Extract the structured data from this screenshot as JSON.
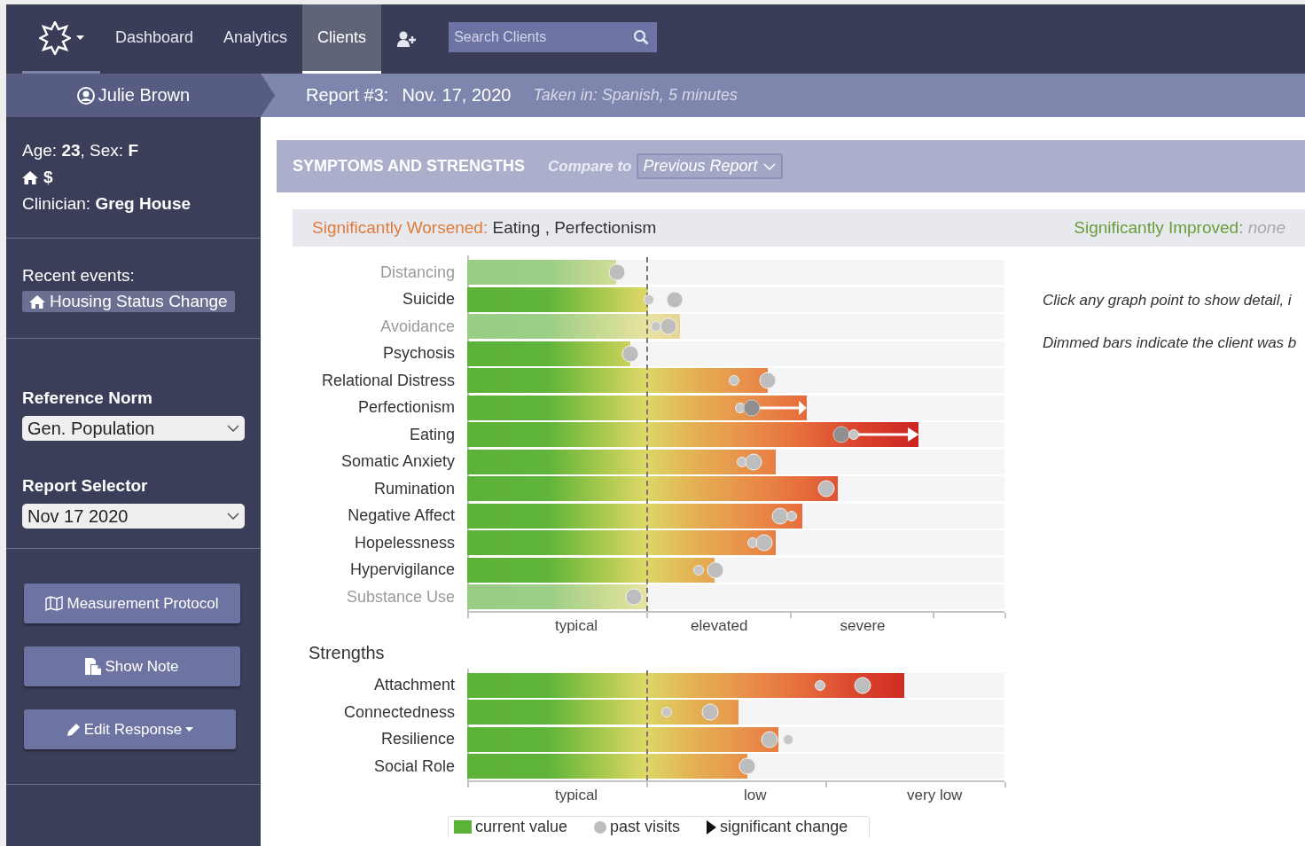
{
  "nav": {
    "items": [
      {
        "label": "Dashboard",
        "selected": false
      },
      {
        "label": "Analytics",
        "selected": false
      },
      {
        "label": "Clients",
        "selected": true
      }
    ],
    "search": {
      "placeholder": "Search Clients"
    }
  },
  "client": {
    "name": "Julie Brown",
    "age_line": "Age: **23**,  Sex: **F**",
    "flag": "$",
    "clinician_line": "Clinician: **Greg House**",
    "events_label": "Recent events:",
    "events": [
      "Housing Status Change"
    ]
  },
  "report": {
    "title": "Report #3:",
    "date": "Nov. 17, 2020",
    "taken": "Taken in: Spanish, 5 minutes"
  },
  "controls": [
    {
      "label": "Reference Norm",
      "value": "Gen. Population"
    },
    {
      "label": "Report Selector",
      "value": "Nov 17 2020"
    }
  ],
  "actions": [
    {
      "label": "Measurement Protocol",
      "kind": "map",
      "has_menu": false
    },
    {
      "label": "Show Note",
      "kind": "note",
      "has_menu": false
    },
    {
      "label": "Edit Response",
      "kind": "edit",
      "has_menu": true
    }
  ],
  "panel": {
    "title": "SYMPTOMS AND STRENGTHS",
    "compare_label": "Compare to",
    "compare_value": "Previous Report",
    "worsened_label": "Significantly Worsened:",
    "worsened": "Eating , Perfectionism",
    "improved_label": "Significantly Improved:",
    "improved": "none",
    "notes": [
      "Click any graph point to show detail, i",
      "Dimmed bars indicate the client was b"
    ]
  },
  "symptoms": {
    "axis_labels": [
      "typical",
      "elevated",
      "severe"
    ],
    "rows": [
      {
        "label": "Distancing",
        "dimmed": true,
        "significant_change": false,
        "level": 0.277,
        "markers": [
          {
            "kind": "large",
            "level": 0.279
          }
        ]
      },
      {
        "label": "Suicide",
        "dimmed": false,
        "significant_change": false,
        "level": 0.337,
        "markers": [
          {
            "kind": "small",
            "level": 0.338
          },
          {
            "kind": "large",
            "level": 0.386
          }
        ]
      },
      {
        "label": "Avoidance",
        "dimmed": true,
        "significant_change": false,
        "level": 0.396,
        "markers": [
          {
            "kind": "small",
            "level": 0.351
          },
          {
            "kind": "large",
            "level": 0.375
          }
        ]
      },
      {
        "label": "Psychosis",
        "dimmed": false,
        "significant_change": false,
        "level": 0.304,
        "markers": [
          {
            "kind": "large",
            "level": 0.304
          }
        ]
      },
      {
        "label": "Relational Distress",
        "dimmed": false,
        "significant_change": false,
        "level": 0.559,
        "markers": [
          {
            "kind": "small",
            "level": 0.497
          },
          {
            "kind": "large",
            "level": 0.559
          }
        ]
      },
      {
        "label": "Perfectionism",
        "dimmed": false,
        "significant_change": true,
        "level": 0.632,
        "markers": [
          {
            "kind": "small",
            "level": 0.508
          },
          {
            "kind": "large-dark",
            "level": 0.53
          }
        ]
      },
      {
        "label": "Eating",
        "dimmed": false,
        "significant_change": true,
        "level": 0.84,
        "markers": [
          {
            "kind": "large-dark",
            "level": 0.696
          },
          {
            "kind": "small",
            "level": 0.719
          }
        ]
      },
      {
        "label": "Somatic Anxiety",
        "dimmed": false,
        "significant_change": false,
        "level": 0.574,
        "markers": [
          {
            "kind": "small",
            "level": 0.512
          },
          {
            "kind": "large",
            "level": 0.533
          }
        ]
      },
      {
        "label": "Rumination",
        "dimmed": false,
        "significant_change": false,
        "level": 0.69,
        "markers": [
          {
            "kind": "large",
            "level": 0.668
          }
        ]
      },
      {
        "label": "Negative Affect",
        "dimmed": false,
        "significant_change": false,
        "level": 0.624,
        "markers": [
          {
            "kind": "large",
            "level": 0.583
          },
          {
            "kind": "small",
            "level": 0.604
          }
        ]
      },
      {
        "label": "Hopelessness",
        "dimmed": false,
        "significant_change": false,
        "level": 0.574,
        "markers": [
          {
            "kind": "small",
            "level": 0.531
          },
          {
            "kind": "large",
            "level": 0.553
          }
        ]
      },
      {
        "label": "Hypervigilance",
        "dimmed": false,
        "significant_change": false,
        "level": 0.46,
        "markers": [
          {
            "kind": "small",
            "level": 0.431
          },
          {
            "kind": "large",
            "level": 0.462
          }
        ]
      },
      {
        "label": "Substance Use",
        "dimmed": true,
        "significant_change": false,
        "level": 0.335,
        "markers": [
          {
            "kind": "large",
            "level": 0.31
          }
        ]
      }
    ]
  },
  "strengths": {
    "title": "Strengths",
    "axis_labels": [
      "typical",
      "low",
      "very low"
    ],
    "rows": [
      {
        "label": "Attachment",
        "dimmed": false,
        "significant_change": false,
        "level": 0.813,
        "markers": [
          {
            "kind": "small",
            "level": 0.657
          },
          {
            "kind": "large",
            "level": 0.736
          }
        ]
      },
      {
        "label": "Connectedness",
        "dimmed": false,
        "significant_change": false,
        "level": 0.505,
        "markers": [
          {
            "kind": "small",
            "level": 0.371
          },
          {
            "kind": "large",
            "level": 0.452
          }
        ]
      },
      {
        "label": "Resilience",
        "dimmed": false,
        "significant_change": false,
        "level": 0.579,
        "markers": [
          {
            "kind": "large",
            "level": 0.563
          },
          {
            "kind": "small",
            "level": 0.597
          }
        ]
      },
      {
        "label": "Social Role",
        "dimmed": false,
        "significant_change": false,
        "level": 0.521,
        "markers": [
          {
            "kind": "large",
            "level": 0.521
          }
        ]
      }
    ]
  },
  "legend": [
    {
      "label": "current value",
      "kind": "bar"
    },
    {
      "label": "past visits",
      "kind": "dot"
    },
    {
      "label": "significant change",
      "kind": "arrow"
    }
  ]
}
